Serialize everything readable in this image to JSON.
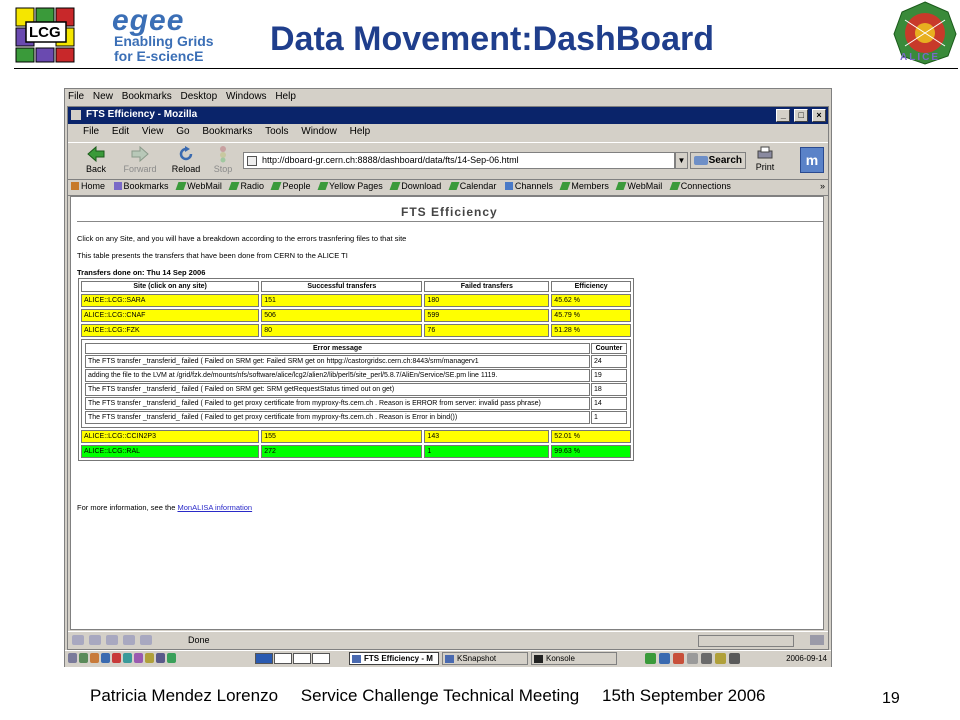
{
  "slide": {
    "title": "Data Movement:DashBoard",
    "logo_lcg": "LCG",
    "logo_egee_name": "egee",
    "logo_egee_tagline_1": "Enabling Grids",
    "logo_egee_tagline_2": "for E-sciencE",
    "logo_alice": "ALICE",
    "footer_author": "Patricia Mendez Lorenzo",
    "footer_event": "Service Challenge Technical Meeting",
    "footer_date": "15th September 2006",
    "page_number": "19"
  },
  "desktop_menu": [
    "File",
    "New",
    "Bookmarks",
    "Desktop",
    "Windows",
    "Help"
  ],
  "browser": {
    "window_title": "FTS Efficiency - Mozilla",
    "window_buttons": [
      "_",
      "□",
      "×"
    ],
    "menu": [
      "File",
      "Edit",
      "View",
      "Go",
      "Bookmarks",
      "Tools",
      "Window",
      "Help"
    ],
    "nav": {
      "back": "Back",
      "forward": "Forward",
      "reload": "Reload",
      "stop": "Stop",
      "url": "http://dboard-gr.cern.ch:8888/dashboard/data/fts/14-Sep-06.html",
      "search": "Search",
      "print": "Print",
      "throbber": "m"
    },
    "bookmarks": [
      "Home",
      "Bookmarks",
      "WebMail",
      "Radio",
      "People",
      "Yellow Pages",
      "Download",
      "Calendar",
      "Channels",
      "Members",
      "WebMail",
      "Connections"
    ],
    "bookmarks_more": "»",
    "status": "Done"
  },
  "page": {
    "heading": "FTS Efficiency",
    "intro_1": "Click on any Site, and you will have a breakdown according to the errors trasnfering files to that site",
    "intro_2": "This table presents the transfers that have been done from CERN to the ALICE TI",
    "transfers_caption": "Transfers done on: Thu 14 Sep 2006",
    "headers": [
      "Site (click on any site)",
      "Successful transfers",
      "Failed transfers",
      "Efficiency"
    ],
    "rows_before": [
      {
        "site": "ALICE::LCG::SARA",
        "success": "151",
        "failed": "180",
        "efficiency": "45.62 %"
      },
      {
        "site": "ALICE::LCG::CNAF",
        "success": "506",
        "failed": "599",
        "efficiency": "45.79 %"
      },
      {
        "site": "ALICE::LCG::FZK",
        "success": "80",
        "failed": "76",
        "efficiency": "51.28 %"
      }
    ],
    "error_headers": [
      "Error message",
      "Counter"
    ],
    "errors": [
      {
        "message": "The FTS transfer _transferid_ failed ( Failed on SRM get: Failed SRM get on httpg://castorgridsc.cern.ch:8443/srm/managerv1",
        "counter": "24"
      },
      {
        "message": "adding the file to the LVM at /grid/fzk.de/mounts/nfs/software/alice/lcg2/alien2/lib/perl5/site_perl/5.8.7/AliEn/Service/SE.pm line 1119.",
        "counter": "19"
      },
      {
        "message": "The FTS transfer _transferid_ failed ( Failed on SRM get: SRM getRequestStatus timed out on get)",
        "counter": "18"
      },
      {
        "message": "The FTS transfer _transferid_ failed ( Failed to get proxy certificate from myproxy-fts.cern.ch . Reason is ERROR from server: invalid pass phrase)",
        "counter": "14"
      },
      {
        "message": "The FTS transfer _transferid_ failed ( Failed to get proxy certificate from myproxy-fts.cern.ch . Reason is Error in bind())",
        "counter": "1"
      }
    ],
    "rows_after": [
      {
        "site": "ALICE::LCG::CCIN2P3",
        "success": "155",
        "failed": "143",
        "efficiency": "52.01 %",
        "status": "yellow"
      },
      {
        "site": "ALICE::LCG::RAL",
        "success": "272",
        "failed": "1",
        "efficiency": "99.63 %",
        "status": "green"
      }
    ],
    "more_info_prefix": "For more information, see the",
    "more_info_link": "MonALISA information"
  },
  "taskbar": {
    "tasks": [
      "FTS Efficiency - M",
      "KSnapshot",
      "Konsole"
    ],
    "clock": "2006-09-14"
  },
  "colors": {
    "title_blue": "#1f3e8c",
    "titlebar": "#0a246a",
    "row_yellow": "#ffff00",
    "row_green": "#00ff00"
  }
}
